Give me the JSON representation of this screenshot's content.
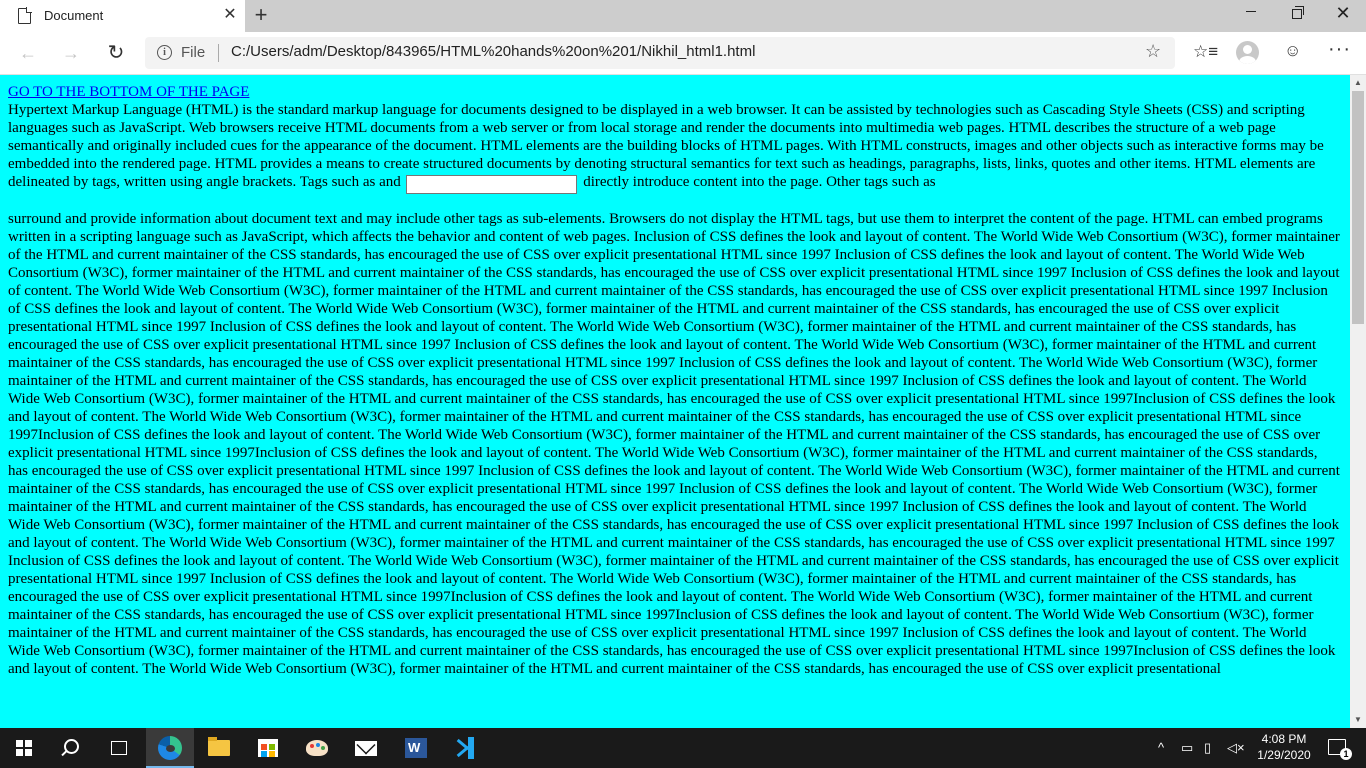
{
  "browser": {
    "tab_title": "Document",
    "tab_close": "✕",
    "new_tab": "+",
    "window_controls": {
      "minimize": "minimize-icon",
      "maximize": "restore-icon",
      "close": "✕"
    },
    "nav": {
      "back": "←",
      "forward": "→",
      "refresh": "↻"
    },
    "address": {
      "info_glyph": "i",
      "scheme_label": "File",
      "url": "C:/Users/adm/Desktop/843965/HTML%20hands%20on%201/Nikhil_html1.html"
    },
    "toolbar_icons": {
      "star": "☆",
      "favorites": "☆≡",
      "feedback": "☺",
      "more": "···"
    }
  },
  "page": {
    "background_color": "#00ffff",
    "bottom_link": "GO TO THE BOTTOM OF THE PAGE",
    "intro_before_input": "Hypertext Markup Language (HTML) is the standard markup language for documents designed to be displayed in a web browser. It can be assisted by technologies such as Cascading Style Sheets (CSS) and scripting languages such as JavaScript. Web browsers receive HTML documents from a web server or from local storage and render the documents into multimedia web pages. HTML describes the structure of a web page semantically and originally included cues for the appearance of the document. HTML elements are the building blocks of HTML pages. With HTML constructs, images and other objects such as interactive forms may be embedded into the rendered page. HTML provides a means to create structured documents by denoting structural semantics for text such as headings, paragraphs, lists, links, quotes and other items. HTML elements are delineated by tags, written using angle brackets. Tags such as  and",
    "intro_input_value": "",
    "intro_after_input": "directly introduce content into the page. Other tags such as",
    "body_text": "surround and provide information about document text and may include other tags as sub-elements. Browsers do not display the HTML tags, but use them to interpret the content of the page. HTML can embed programs written in a scripting language such as JavaScript, which affects the behavior and content of web pages. Inclusion of CSS defines the look and layout of content. The World Wide Web Consortium (W3C), former maintainer of the HTML and current maintainer of the CSS standards, has encouraged the use of CSS over explicit presentational HTML since 1997 Inclusion of CSS defines the look and layout of content. The World Wide Web Consortium (W3C), former maintainer of the HTML and current maintainer of the CSS standards, has encouraged the use of CSS over explicit presentational HTML since 1997 Inclusion of CSS defines the look and layout of content. The World Wide Web Consortium (W3C), former maintainer of the HTML and current maintainer of the CSS standards, has encouraged the use of CSS over explicit presentational HTML since 1997 Inclusion of CSS defines the look and layout of content. The World Wide Web Consortium (W3C), former maintainer of the HTML and current maintainer of the CSS standards, has encouraged the use of CSS over explicit presentational HTML since 1997 Inclusion of CSS defines the look and layout of content. The World Wide Web Consortium (W3C), former maintainer of the HTML and current maintainer of the CSS standards, has encouraged the use of CSS over explicit presentational HTML since 1997 Inclusion of CSS defines the look and layout of content. The World Wide Web Consortium (W3C), former maintainer of the HTML and current maintainer of the CSS standards, has encouraged the use of CSS over explicit presentational HTML since 1997 Inclusion of CSS defines the look and layout of content. The World Wide Web Consortium (W3C), former maintainer of the HTML and current maintainer of the CSS standards, has encouraged the use of CSS over explicit presentational HTML since 1997 Inclusion of CSS defines the look and layout of content. The World Wide Web Consortium (W3C), former maintainer of the HTML and current maintainer of the CSS standards, has encouraged the use of CSS over explicit presentational HTML since 1997Inclusion of CSS defines the look and layout of content. The World Wide Web Consortium (W3C), former maintainer of the HTML and current maintainer of the CSS standards, has encouraged the use of CSS over explicit presentational HTML since 1997Inclusion of CSS defines the look and layout of content. The World Wide Web Consortium (W3C), former maintainer of the HTML and current maintainer of the CSS standards, has encouraged the use of CSS over explicit presentational HTML since 1997Inclusion of CSS defines the look and layout of content. The World Wide Web Consortium (W3C), former maintainer of the HTML and current maintainer of the CSS standards, has encouraged the use of CSS over explicit presentational HTML since 1997 Inclusion of CSS defines the look and layout of content. The World Wide Web Consortium (W3C), former maintainer of the HTML and current maintainer of the CSS standards, has encouraged the use of CSS over explicit presentational HTML since 1997 Inclusion of CSS defines the look and layout of content. The World Wide Web Consortium (W3C), former maintainer of the HTML and current maintainer of the CSS standards, has encouraged the use of CSS over explicit presentational HTML since 1997 Inclusion of CSS defines the look and layout of content. The World Wide Web Consortium (W3C), former maintainer of the HTML and current maintainer of the CSS standards, has encouraged the use of CSS over explicit presentational HTML since 1997 Inclusion of CSS defines the look and layout of content. The World Wide Web Consortium (W3C), former maintainer of the HTML and current maintainer of the CSS standards, has encouraged the use of CSS over explicit presentational HTML since 1997 Inclusion of CSS defines the look and layout of content. The World Wide Web Consortium (W3C), former maintainer of the HTML and current maintainer of the CSS standards, has encouraged the use of CSS over explicit presentational HTML since 1997 Inclusion of CSS defines the look and layout of content. The World Wide Web Consortium (W3C), former maintainer of the HTML and current maintainer of the CSS standards, has encouraged the use of CSS over explicit presentational HTML since 1997Inclusion of CSS defines the look and layout of content. The World Wide Web Consortium (W3C), former maintainer of the HTML and current maintainer of the CSS standards, has encouraged the use of CSS over explicit presentational HTML since 1997Inclusion of CSS defines the look and layout of content. The World Wide Web Consortium (W3C), former maintainer of the HTML and current maintainer of the CSS standards, has encouraged the use of CSS over explicit presentational HTML since 1997 Inclusion of CSS defines the look and layout of content. The World Wide Web Consortium (W3C), former maintainer of the HTML and current maintainer of the CSS standards, has encouraged the use of CSS over explicit presentational HTML since 1997Inclusion of CSS defines the look and layout of content. The World Wide Web Consortium (W3C), former maintainer of the HTML and current maintainer of the CSS standards, has encouraged the use of CSS over explicit presentational"
  },
  "taskbar": {
    "apps": [
      "start",
      "search",
      "task-view",
      "edge",
      "file-explorer",
      "microsoft-store",
      "paint",
      "mail",
      "word",
      "vscode"
    ],
    "word_letter": "W",
    "tray": {
      "chevron": "^",
      "battery": "▭",
      "network": "▯",
      "volume": "◁×",
      "time": "4:08 PM",
      "date": "1/29/2020",
      "notifications": "1"
    }
  }
}
